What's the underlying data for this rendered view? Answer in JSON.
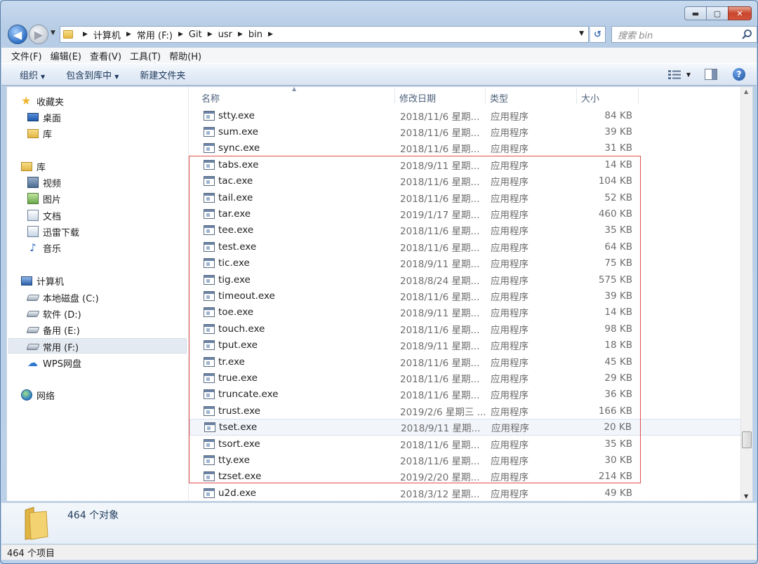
{
  "window": {
    "min_glyph": "▬",
    "max_glyph": "▢",
    "close_glyph": "✕"
  },
  "address": {
    "segments": [
      "计算机",
      "常用 (F:)",
      "Git",
      "usr",
      "bin"
    ],
    "search_placeholder": "搜索 bin"
  },
  "menu": [
    "文件(F)",
    "编辑(E)",
    "查看(V)",
    "工具(T)",
    "帮助(H)"
  ],
  "toolbar": {
    "organize": "组织",
    "include_library": "包含到库中",
    "new_folder": "新建文件夹"
  },
  "nav": {
    "favorites": "收藏夹",
    "desktop": "桌面",
    "library_fav": "库",
    "library": "库",
    "video": "视频",
    "pictures": "图片",
    "documents": "文档",
    "xunlei": "迅雷下载",
    "music": "音乐",
    "computer": "计算机",
    "drive_c": "本地磁盘 (C:)",
    "drive_d": "软件 (D:)",
    "drive_e": "备用 (E:)",
    "drive_f": "常用 (F:)",
    "wps": "WPS网盘",
    "network": "网络"
  },
  "columns": {
    "name": "名称",
    "date": "修改日期",
    "type": "类型",
    "size": "大小"
  },
  "files": [
    {
      "name": "stty.exe",
      "date": "2018/11/6 星期...",
      "type": "应用程序",
      "size": "84 KB"
    },
    {
      "name": "sum.exe",
      "date": "2018/11/6 星期...",
      "type": "应用程序",
      "size": "39 KB"
    },
    {
      "name": "sync.exe",
      "date": "2018/11/6 星期...",
      "type": "应用程序",
      "size": "31 KB"
    },
    {
      "name": "tabs.exe",
      "date": "2018/9/11 星期...",
      "type": "应用程序",
      "size": "14 KB"
    },
    {
      "name": "tac.exe",
      "date": "2018/11/6 星期...",
      "type": "应用程序",
      "size": "104 KB"
    },
    {
      "name": "tail.exe",
      "date": "2018/11/6 星期...",
      "type": "应用程序",
      "size": "52 KB"
    },
    {
      "name": "tar.exe",
      "date": "2019/1/17 星期...",
      "type": "应用程序",
      "size": "460 KB"
    },
    {
      "name": "tee.exe",
      "date": "2018/11/6 星期...",
      "type": "应用程序",
      "size": "35 KB"
    },
    {
      "name": "test.exe",
      "date": "2018/11/6 星期...",
      "type": "应用程序",
      "size": "64 KB"
    },
    {
      "name": "tic.exe",
      "date": "2018/9/11 星期...",
      "type": "应用程序",
      "size": "75 KB"
    },
    {
      "name": "tig.exe",
      "date": "2018/8/24 星期...",
      "type": "应用程序",
      "size": "575 KB"
    },
    {
      "name": "timeout.exe",
      "date": "2018/11/6 星期...",
      "type": "应用程序",
      "size": "39 KB"
    },
    {
      "name": "toe.exe",
      "date": "2018/9/11 星期...",
      "type": "应用程序",
      "size": "14 KB"
    },
    {
      "name": "touch.exe",
      "date": "2018/11/6 星期...",
      "type": "应用程序",
      "size": "98 KB"
    },
    {
      "name": "tput.exe",
      "date": "2018/9/11 星期...",
      "type": "应用程序",
      "size": "18 KB"
    },
    {
      "name": "tr.exe",
      "date": "2018/11/6 星期...",
      "type": "应用程序",
      "size": "45 KB"
    },
    {
      "name": "true.exe",
      "date": "2018/11/6 星期...",
      "type": "应用程序",
      "size": "29 KB"
    },
    {
      "name": "truncate.exe",
      "date": "2018/11/6 星期...",
      "type": "应用程序",
      "size": "36 KB"
    },
    {
      "name": "trust.exe",
      "date": "2019/2/6 星期三 ...",
      "type": "应用程序",
      "size": "166 KB"
    },
    {
      "name": "tset.exe",
      "date": "2018/9/11 星期...",
      "type": "应用程序",
      "size": "20 KB"
    },
    {
      "name": "tsort.exe",
      "date": "2018/11/6 星期...",
      "type": "应用程序",
      "size": "35 KB"
    },
    {
      "name": "tty.exe",
      "date": "2018/11/6 星期...",
      "type": "应用程序",
      "size": "30 KB"
    },
    {
      "name": "tzset.exe",
      "date": "2019/2/20 星期...",
      "type": "应用程序",
      "size": "214 KB"
    },
    {
      "name": "u2d.exe",
      "date": "2018/3/12 星期...",
      "type": "应用程序",
      "size": "49 KB"
    }
  ],
  "details": {
    "count": "464 个对象"
  },
  "status": {
    "text": "464 个项目"
  },
  "colors": {
    "highlight_box": "#e0504a",
    "selection_bg": "#e4eaf1"
  }
}
